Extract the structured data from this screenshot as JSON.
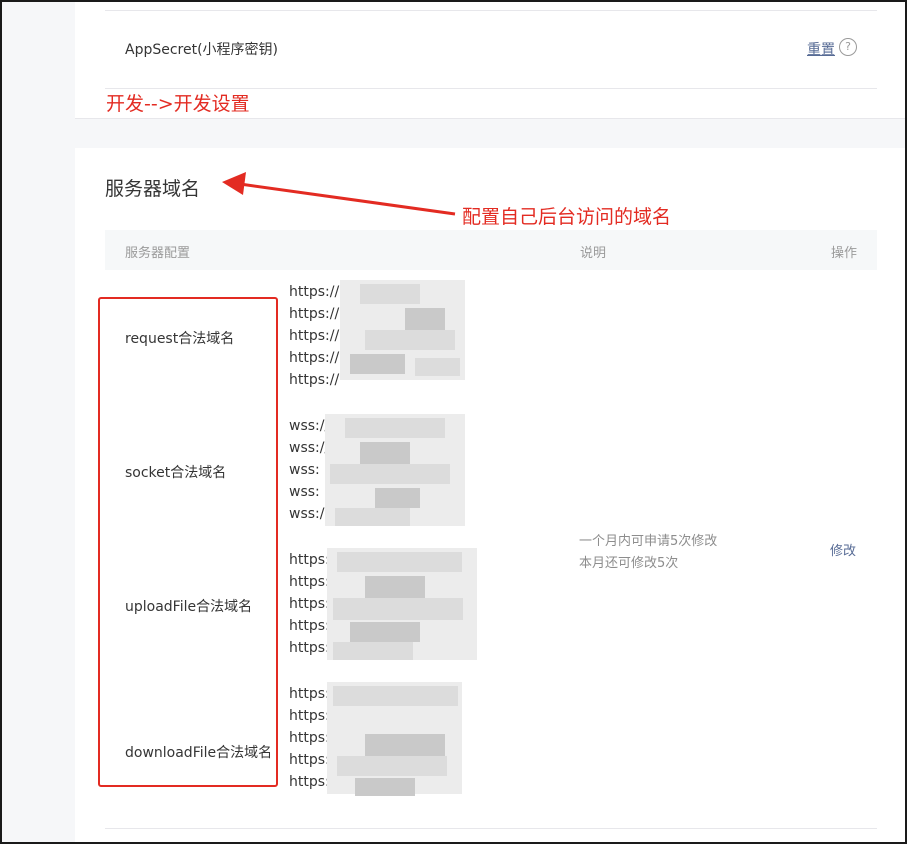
{
  "appsecret": {
    "label": "AppSecret(小程序密钥)",
    "reset_label": "重置",
    "help_icon": "question-circle-icon"
  },
  "annotations": {
    "dev_path": "开发-->开发设置",
    "domain_note": "配置自己后台访问的域名"
  },
  "server_section": {
    "title": "服务器域名",
    "columns": {
      "config": "服务器配置",
      "description": "说明",
      "operation": "操作"
    },
    "rows": [
      {
        "label": "request合法域名",
        "urls": [
          "https://",
          "https://",
          "https://",
          "https://",
          "https://"
        ]
      },
      {
        "label": "socket合法域名",
        "urls": [
          "wss://",
          "wss://",
          "wss:",
          "wss:",
          "wss:/"
        ]
      },
      {
        "label": "uploadFile合法域名",
        "urls": [
          "https:",
          "https:",
          "https:",
          "https:",
          "https:"
        ]
      },
      {
        "label": "downloadFile合法域名",
        "urls": [
          "https:",
          "https:",
          "https://",
          "https://",
          "https://"
        ]
      }
    ],
    "description_lines": [
      "一个月内可申请5次修改",
      "本月还可修改5次"
    ],
    "modify_label": "修改"
  },
  "colors": {
    "annotation_red": "#e32b22",
    "link_blue": "#576b95"
  }
}
